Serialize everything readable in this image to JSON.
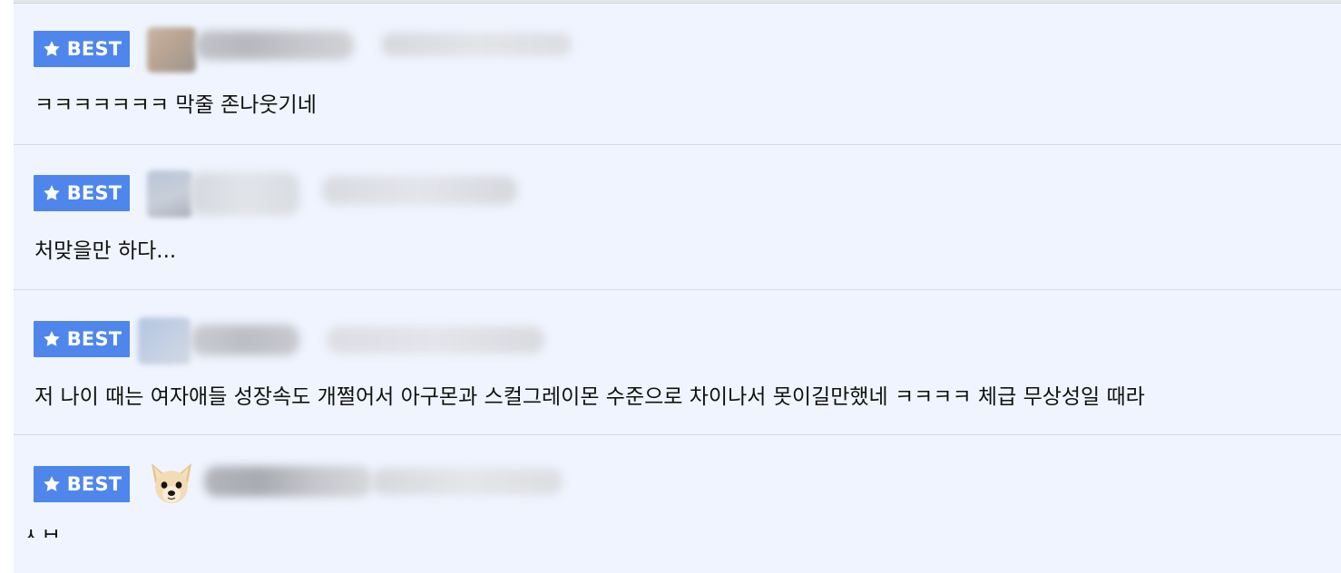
{
  "badge_label": "BEST",
  "comments": [
    {
      "text": "ㅋㅋㅋㅋㅋㅋㅋ 막줄 존나웃기네"
    },
    {
      "text": "처맞을만 하다..."
    },
    {
      "text": "저 나이 때는 여자애들 성장속도 개쩔어서 아구몬과 스컬그레이몬 수준으로 차이나서 못이길만했네 ㅋㅋㅋㅋ 체급 무상성일 때라"
    },
    {
      "text": "ㅅㅂ"
    }
  ],
  "colors": {
    "badge_bg": "#4f86ec",
    "list_bg": "#eff4fe",
    "divider": "#d6d9df"
  },
  "icons": {
    "badge": "star-icon",
    "avatar_4": "dog-avatar-icon"
  }
}
